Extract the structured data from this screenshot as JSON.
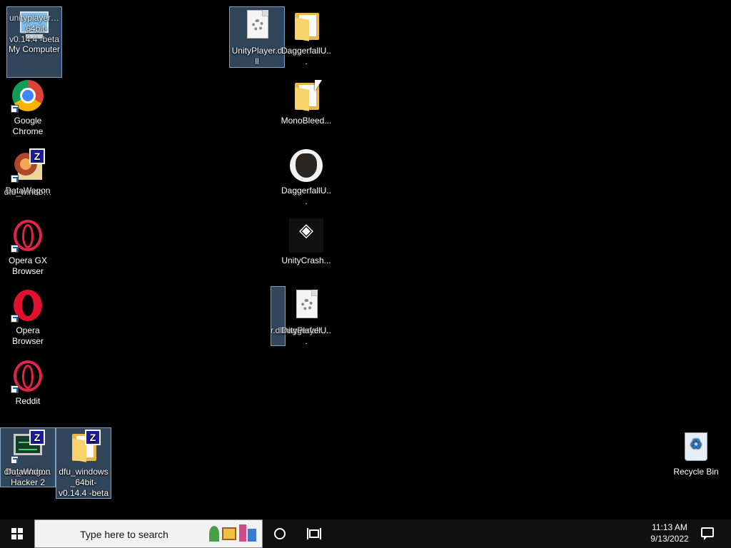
{
  "desktop": {
    "icons": {
      "mycomputer": {
        "label": "My Computer",
        "overlap": "unityplayer… _64bit-v0.14.4 -beta"
      },
      "chrome": {
        "label": "Google Chrome"
      },
      "datawagon1": {
        "label": "DataWagon",
        "overlap": "dfu_windo…"
      },
      "operagx": {
        "label": "Opera GX Browser"
      },
      "opera": {
        "label": "Opera Browser"
      },
      "reddit": {
        "label": "Reddit"
      },
      "hacker": {
        "label": "DataWagon Hacker 2",
        "overlap": "dfu_windo…"
      },
      "dfuwindows": {
        "label": "dfu_windows _64bit-v0.14.4 -beta"
      },
      "unityplayerdll": {
        "label": "UnityPlayer.dll"
      },
      "daggerfallfolder": {
        "label": "DaggerfallU..."
      },
      "monobleed": {
        "label": "MonoBleed..."
      },
      "daggerfallexe": {
        "label": "DaggerfallU..."
      },
      "unitycrash": {
        "label": "UnityCrash..."
      },
      "daggerfalldrag": {
        "label": "DaggerfallU...",
        "overlap": "r.dllnityPlayer..."
      },
      "recyclebin": {
        "label": "Recycle Bin"
      }
    }
  },
  "taskbar": {
    "search_placeholder": "Type here to search",
    "time": "11:13 AM",
    "date": "9/13/2022"
  }
}
